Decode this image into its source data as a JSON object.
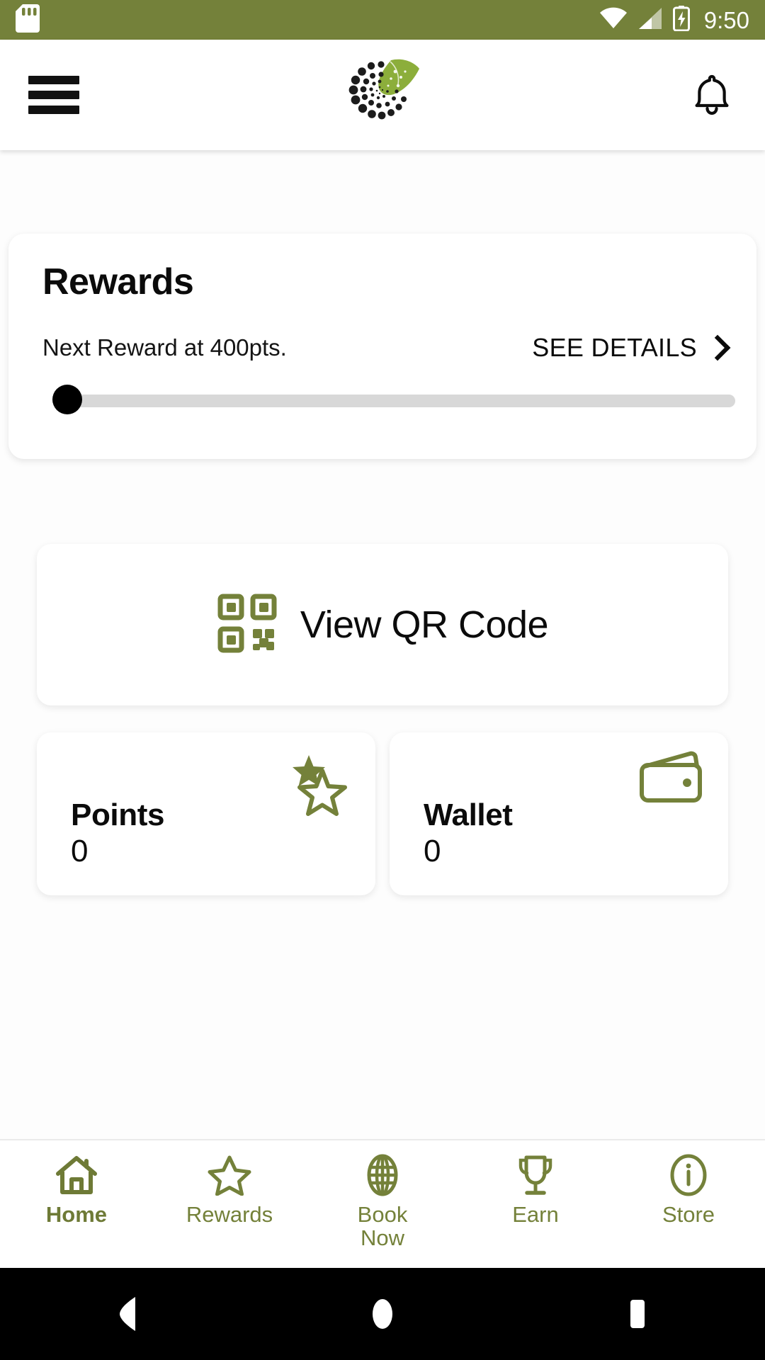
{
  "theme": {
    "accent_green": "#74813A",
    "text_dark": "#0b0b0b",
    "track_gray": "#d8d8d8",
    "card_white": "#ffffff",
    "page_bg": "#fdfdfd",
    "sysnav_black": "#000000"
  },
  "status_bar": {
    "sd_card_icon": "sd-card-icon",
    "wifi_icon": "wifi-icon",
    "signal_icon": "cellular-signal-icon",
    "battery_icon": "battery-charging-icon",
    "time": "9:50"
  },
  "app_bar": {
    "menu_icon": "hamburger-menu-icon",
    "logo_icon": "brand-spiral-leaf-logo",
    "notifications_icon": "notification-bell-icon"
  },
  "rewards_card": {
    "title": "Rewards",
    "subtitle": "Next Reward at 400pts.",
    "see_details_label": "SEE DETAILS",
    "chevron_icon": "chevron-right-icon",
    "progress_percent": 0,
    "progress_current_points": 0,
    "progress_target_points": 400
  },
  "qr_card": {
    "icon": "qr-code-icon",
    "label": "View QR Code"
  },
  "stats": [
    {
      "label": "Points",
      "value": "0",
      "icon": "two-stars-icon"
    },
    {
      "label": "Wallet",
      "value": "0",
      "icon": "wallet-icon"
    }
  ],
  "bottom_nav": {
    "items": [
      {
        "label": "Home",
        "icon": "home-icon",
        "active": true
      },
      {
        "label": "Rewards",
        "icon": "star-outline-icon",
        "active": false
      },
      {
        "label": "Book\nNow",
        "label_line1": "Book",
        "label_line2": "Now",
        "icon": "globe-icon",
        "active": false
      },
      {
        "label": "Earn",
        "icon": "trophy-icon",
        "active": false
      },
      {
        "label": "Store",
        "icon": "info-circle-icon",
        "active": false
      }
    ]
  },
  "system_nav": {
    "back_label": "back-button",
    "home_label": "home-button",
    "recents_label": "recents-button"
  }
}
